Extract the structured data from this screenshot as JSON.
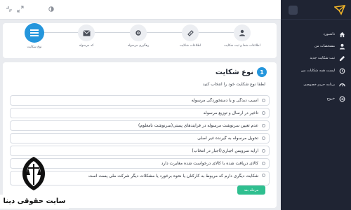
{
  "sidebar": {
    "items": [
      {
        "label": "داشبورد",
        "icon": "home-icon"
      },
      {
        "label": "مشخصات من",
        "icon": "user-icon"
      },
      {
        "label": "ثبت شکایت جدید",
        "icon": "edit-icon"
      },
      {
        "label": "لیست همه شکایات من",
        "icon": "history-icon"
      },
      {
        "label": "برنامه حریم خصوصی",
        "icon": "gauge-icon"
      },
      {
        "label": "خروج",
        "icon": "logout-icon"
      }
    ],
    "accent": "#2596dc"
  },
  "steps": [
    {
      "label": "اطلاعات شما و ثبت شکایت",
      "icon": "user-icon"
    },
    {
      "label": "اطلاعات شکایت",
      "icon": "ticket-icon"
    },
    {
      "label": "رهگیری مرسوله",
      "icon": "gear-icon"
    },
    {
      "label": "کد مرسوله",
      "icon": "envelope-icon"
    },
    {
      "label": "نوع شکایت",
      "icon": "list-icon",
      "active": true
    }
  ],
  "card": {
    "number": "1",
    "title": "نوع شکایت",
    "subtitle": "لطفا نوع شکایت خود را انتخاب کنید",
    "options": [
      "آسیب دیدگی و یا دستخوردگی مرسوله",
      "تاخیر در ارسال و توزیع مرسوله",
      "عدم تعیین سرنوشت مرسوله در فرایندهای پستی(سرنوشت نامعلوم)",
      "تحویل مرسوله به گیرنده غیر اصلی",
      "ارایه سرویس اجباری(اجبار در انتخاب)",
      "کالای دریافت شده با کالای درخواست شده مغایرت دارد",
      "شکایت دیگری دارم که مربوط به کارکنان یا نحوه برخورد یا مشکلات دیگر شرکت ملی پست است"
    ],
    "submit_label": "مرحله بعد"
  },
  "watermark": {
    "text": "سایت حقوقی دینا"
  },
  "colors": {
    "sidebar_bg": "#1f2433",
    "accent": "#2596dc",
    "submit": "#2fbf8f",
    "logo": "#f0b429"
  }
}
